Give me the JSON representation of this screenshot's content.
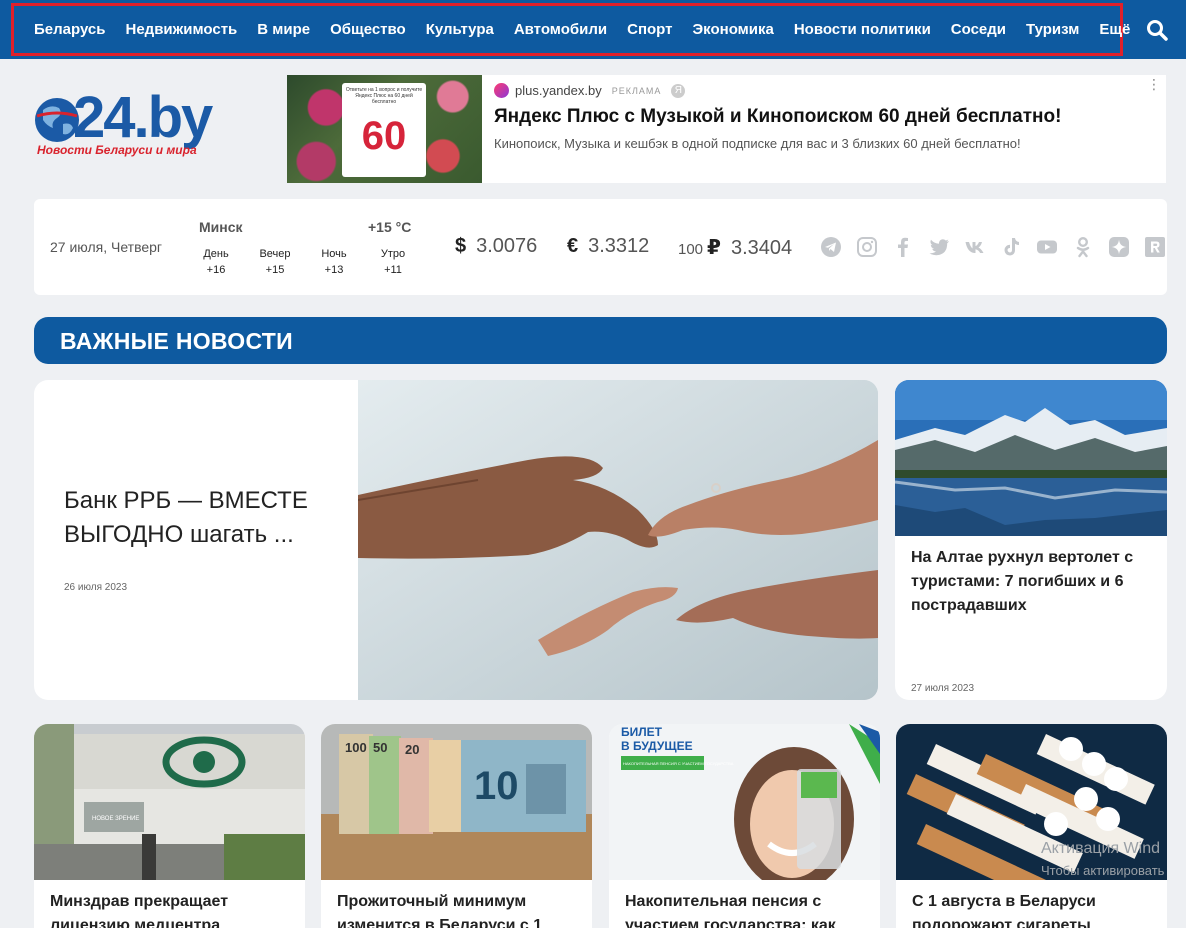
{
  "nav": {
    "items": [
      "Беларусь",
      "Недвижимость",
      "В мире",
      "Общество",
      "Культура",
      "Автомобили",
      "Спорт",
      "Экономика",
      "Новости политики",
      "Соседи",
      "Туризм",
      "Ещё"
    ],
    "search_icon": "search-icon"
  },
  "logo": {
    "text": "24.by",
    "subtitle": "Новости Беларуси и мира"
  },
  "ad": {
    "card_small": "Ответьте на 1 вопрос и получите Яндекс Плюс на 60 дней бесплатно",
    "card_number": "60",
    "domain": "plus.yandex.by",
    "label": "РЕКЛАМА",
    "ya": "Я",
    "title": "Яндекс Плюс с Музыкой и Кинопоиском 60 дней бесплатно!",
    "description": "Кинопоиск, Музыка и кешбэк в одной подписке для вас и 3 близких 60 дней бесплатно!"
  },
  "info": {
    "date": "27 июля, Четверг",
    "city": "Минск",
    "temp_now": "+15 °С",
    "forecast": [
      {
        "label": "День",
        "value": "+16"
      },
      {
        "label": "Вечер",
        "value": "+15"
      },
      {
        "label": "Ночь",
        "value": "+13"
      },
      {
        "label": "Утро",
        "value": "+11"
      }
    ],
    "currency": [
      {
        "symbol": "$",
        "prefix": "",
        "value": "3.0076"
      },
      {
        "symbol": "€",
        "prefix": "",
        "value": "3.3312"
      },
      {
        "symbol": "₽",
        "prefix": "100",
        "value": "3.3404"
      }
    ],
    "socials": [
      "telegram-icon",
      "instagram-icon",
      "facebook-icon",
      "twitter-icon",
      "vk-icon",
      "tiktok-icon",
      "youtube-icon",
      "odnoklassniki-icon",
      "zen-icon",
      "rutube-icon"
    ]
  },
  "section": {
    "title": "ВАЖНЫЕ НОВОСТИ"
  },
  "hero": {
    "title": "Банк РРБ — ВМЕСТЕ ВЫГОДНО шагать ...",
    "date": "26 июля 2023"
  },
  "side": {
    "title": "На Алтае рухнул вертолет с туристами: 7 погибших и 6 пострадавших",
    "date": "27 июля 2023"
  },
  "cards": [
    {
      "title": "Минздрав прекращает лицензию медцентра",
      "sign": "НОВОЕ ЗРЕНИЕ"
    },
    {
      "title": "Прожиточный минимум изменится в Беларуси с 1",
      "notes": [
        "100",
        "50",
        "20",
        "10"
      ]
    },
    {
      "title": "Накопительная пенсия с участием государства: как",
      "banner_line1": "БИЛЕТ",
      "banner_line2": "В БУДУЩЕЕ",
      "banner_small": "НАКОПИТЕЛЬНАЯ ПЕНСИЯ С УЧАСТИЕМ ГОСУДАРСТВА"
    },
    {
      "title": "С 1 августа в Беларуси подорожают сигареты"
    }
  ],
  "watermark": {
    "line1": "Активация Wind",
    "line2": "Чтобы активировать"
  }
}
